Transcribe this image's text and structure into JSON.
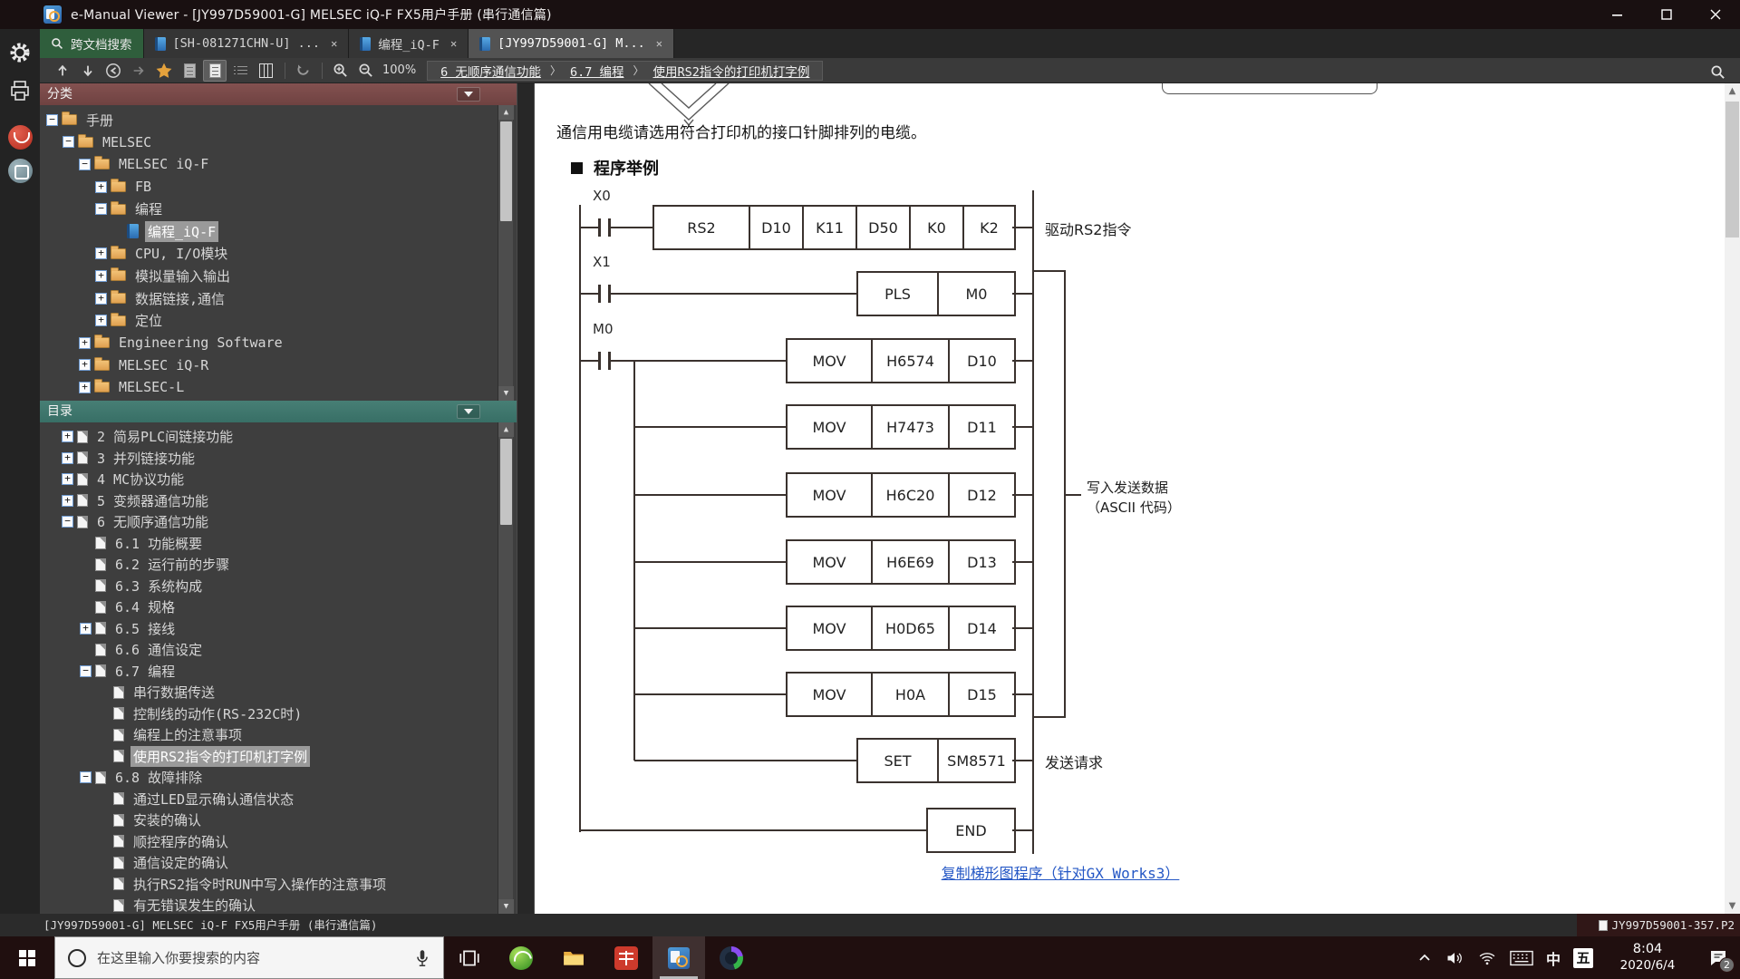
{
  "window": {
    "title": "e-Manual Viewer - [JY997D59001-G] MELSEC iQ-F FX5用户手册 (串行通信篇)"
  },
  "tabs": [
    {
      "label": "跨文档搜索",
      "kind": "search",
      "active": false,
      "closable": false
    },
    {
      "label": "[SH-081271CHN-U] ...",
      "kind": "document",
      "active": false,
      "closable": true
    },
    {
      "label": "编程_iQ-F",
      "kind": "document",
      "active": false,
      "closable": true
    },
    {
      "label": "[JY997D59001-G] M...",
      "kind": "document",
      "active": true,
      "closable": true
    }
  ],
  "toolbar": {
    "zoom_level": "100%",
    "breadcrumb": [
      "6 无顺序通信功能",
      "6.7 编程",
      "使用RS2指令的打印机打字例"
    ]
  },
  "sidebar": {
    "category": {
      "title": "分类",
      "items": [
        {
          "label": "手册",
          "depth": 0,
          "expander": "-",
          "icon": "folder"
        },
        {
          "label": "MELSEC",
          "depth": 1,
          "expander": "-",
          "icon": "folder"
        },
        {
          "label": "MELSEC iQ-F",
          "depth": 2,
          "expander": "-",
          "icon": "folder"
        },
        {
          "label": "FB",
          "depth": 3,
          "expander": "+",
          "icon": "folder"
        },
        {
          "label": "编程",
          "depth": 3,
          "expander": "-",
          "icon": "folder"
        },
        {
          "label": "编程_iQ-F",
          "depth": 4,
          "icon": "book",
          "selected": true
        },
        {
          "label": "CPU, I/O模块",
          "depth": 3,
          "expander": "+",
          "icon": "folder"
        },
        {
          "label": "模拟量输入输出",
          "depth": 3,
          "expander": "+",
          "icon": "folder"
        },
        {
          "label": "数据链接,通信",
          "depth": 3,
          "expander": "+",
          "icon": "folder"
        },
        {
          "label": "定位",
          "depth": 3,
          "expander": "+",
          "icon": "folder"
        },
        {
          "label": "Engineering Software",
          "depth": 2,
          "expander": "+",
          "icon": "folder"
        },
        {
          "label": "MELSEC iQ-R",
          "depth": 2,
          "expander": "+",
          "icon": "folder"
        },
        {
          "label": "MELSEC-L",
          "depth": 2,
          "expander": "+",
          "icon": "folder"
        }
      ]
    },
    "toc": {
      "title": "目录",
      "items": [
        {
          "label": "2 简易PLC间链接功能",
          "depth": 0,
          "expander": "+",
          "icon": "page"
        },
        {
          "label": "3 并列链接功能",
          "depth": 0,
          "expander": "+",
          "icon": "page"
        },
        {
          "label": "4 MC协议功能",
          "depth": 0,
          "expander": "+",
          "icon": "page"
        },
        {
          "label": "5 变频器通信功能",
          "depth": 0,
          "expander": "+",
          "icon": "page"
        },
        {
          "label": "6 无顺序通信功能",
          "depth": 0,
          "expander": "-",
          "icon": "page"
        },
        {
          "label": "6.1 功能概要",
          "depth": 1,
          "icon": "page"
        },
        {
          "label": "6.2 运行前的步骤",
          "depth": 1,
          "icon": "page"
        },
        {
          "label": "6.3 系统构成",
          "depth": 1,
          "icon": "page"
        },
        {
          "label": "6.4 规格",
          "depth": 1,
          "icon": "page"
        },
        {
          "label": "6.5 接线",
          "depth": 1,
          "expander": "+",
          "icon": "page"
        },
        {
          "label": "6.6 通信设定",
          "depth": 1,
          "icon": "page"
        },
        {
          "label": "6.7 编程",
          "depth": 1,
          "expander": "-",
          "icon": "page"
        },
        {
          "label": "串行数据传送",
          "depth": 2,
          "icon": "page"
        },
        {
          "label": "控制线的动作(RS-232C时)",
          "depth": 2,
          "icon": "page"
        },
        {
          "label": "编程上的注意事项",
          "depth": 2,
          "icon": "page"
        },
        {
          "label": "使用RS2指令的打印机打字例",
          "depth": 2,
          "icon": "page",
          "selected": true
        },
        {
          "label": "6.8 故障排除",
          "depth": 1,
          "expander": "-",
          "icon": "page"
        },
        {
          "label": "通过LED显示确认通信状态",
          "depth": 2,
          "icon": "page"
        },
        {
          "label": "安装的确认",
          "depth": 2,
          "icon": "page"
        },
        {
          "label": "顺控程序的确认",
          "depth": 2,
          "icon": "page"
        },
        {
          "label": "通信设定的确认",
          "depth": 2,
          "icon": "page"
        },
        {
          "label": "执行RS2指令时RUN中写入操作的注意事项",
          "depth": 2,
          "icon": "page"
        },
        {
          "label": "有无错误发生的确认",
          "depth": 2,
          "icon": "page"
        }
      ]
    }
  },
  "content": {
    "paragraph": "通信用电缆请选用符合打印机的接口针脚排列的电缆。",
    "heading": "程序举例",
    "ladder": {
      "rungs": [
        {
          "contact": "X0",
          "cells": [
            "RS2",
            "D10",
            "K11",
            "D50",
            "K0",
            "K2"
          ],
          "comment": "驱动RS2指令"
        },
        {
          "contact": "X1",
          "cells": [
            "PLS",
            "M0"
          ]
        },
        {
          "contact": "M0",
          "cells": [
            "MOV",
            "H6574",
            "D10"
          ]
        },
        {
          "cells": [
            "MOV",
            "H7473",
            "D11"
          ]
        },
        {
          "cells": [
            "MOV",
            "H6C20",
            "D12"
          ]
        },
        {
          "cells": [
            "MOV",
            "H6E69",
            "D13"
          ]
        },
        {
          "cells": [
            "MOV",
            "H0D65",
            "D14"
          ]
        },
        {
          "cells": [
            "MOV",
            "H0A",
            "D15"
          ]
        },
        {
          "cells": [
            "SET",
            "SM8571"
          ],
          "comment": "发送请求"
        },
        {
          "cells": [
            "END"
          ]
        }
      ],
      "group_label": [
        "写入发送数据",
        "（ASCII 代码）"
      ]
    },
    "copy_link": "复制梯形图程序（针对GX Works3）"
  },
  "statusbar": {
    "left": "[JY997D59001-G] MELSEC iQ-F FX5用户手册 (串行通信篇)",
    "right": "JY997D59001-357.P2"
  },
  "taskbar": {
    "search_placeholder": "在这里输入你要搜索的内容",
    "ime_lang": "中",
    "ime_mode": "五",
    "time": "8:04",
    "date": "2020/6/4",
    "notification_count": "2"
  },
  "colors": {
    "category_header": "#6f4241",
    "toc_header": "#386f66",
    "search_tab_green": "#2f5e3c",
    "link_blue": "#2457c5",
    "taskbar_maroon": "#200f0f",
    "selection_gray": "#9a9a9a",
    "favorite_star": "#e5a23c"
  }
}
